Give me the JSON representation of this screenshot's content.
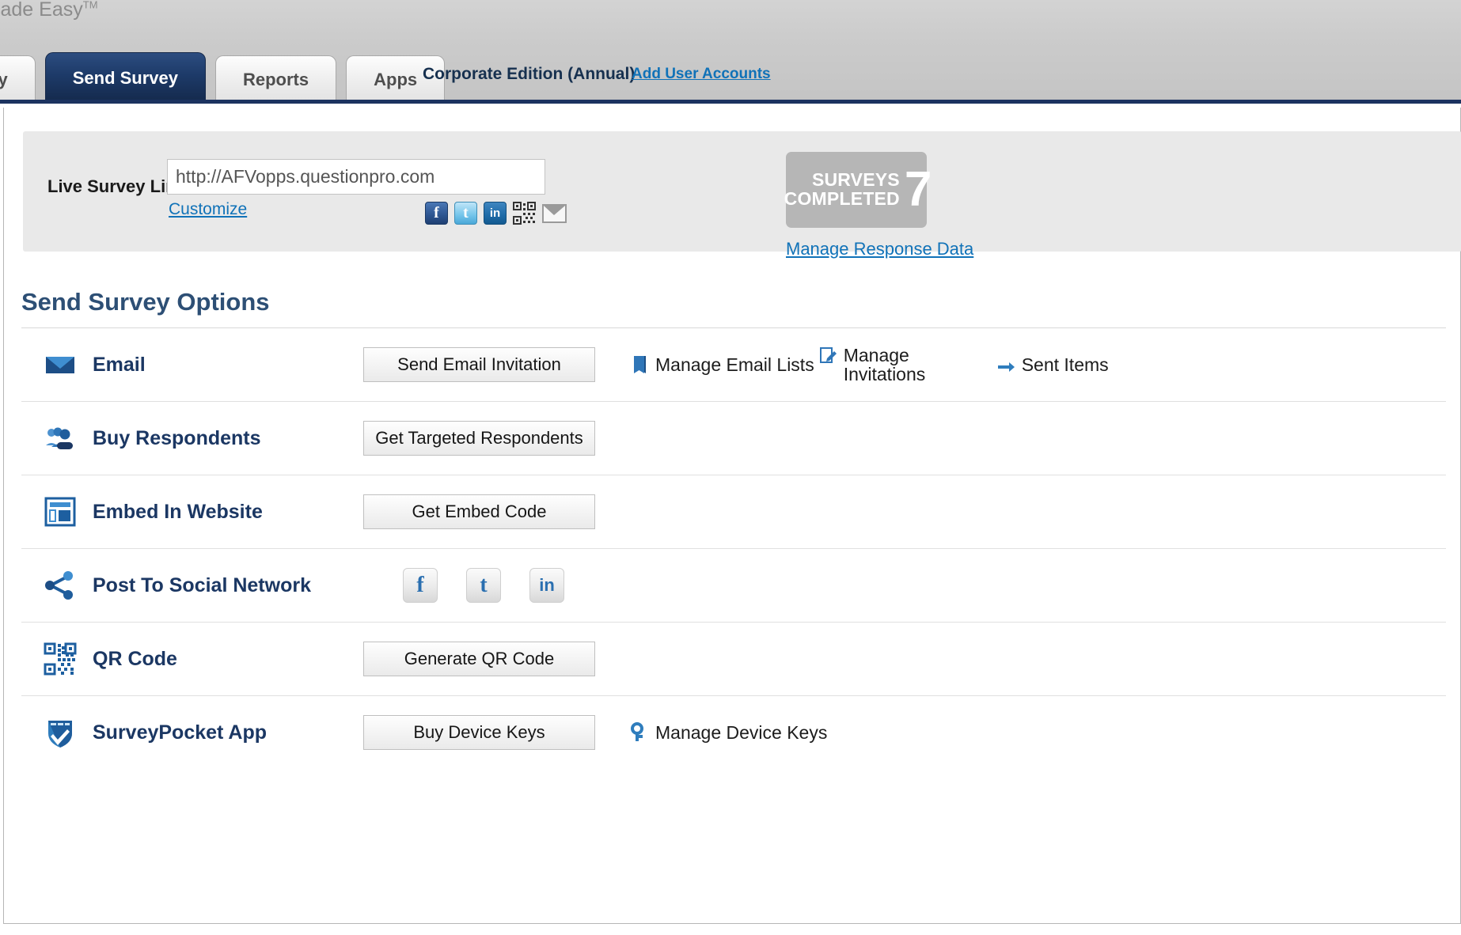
{
  "header": {
    "tagline": "rch Made Easy",
    "tagline_tm": "TM",
    "tabs": [
      {
        "label": "vey",
        "active": false,
        "name": "tab-survey"
      },
      {
        "label": "Send Survey",
        "active": true,
        "name": "tab-send-survey"
      },
      {
        "label": "Reports",
        "active": false,
        "name": "tab-reports"
      },
      {
        "label": "Apps",
        "active": false,
        "name": "tab-apps"
      }
    ],
    "edition": "Corporate Edition (Annual)",
    "add_user_accounts": "Add User Accounts"
  },
  "link_panel": {
    "label": "Live Survey Link",
    "url_value": "http://AFVopps.questionpro.com",
    "url_placeholder": "http://",
    "customize": "Customize",
    "share_icons": [
      {
        "name": "facebook-share-icon",
        "glyph": "f"
      },
      {
        "name": "twitter-share-icon",
        "glyph": "t"
      },
      {
        "name": "linkedin-share-icon",
        "glyph": "in"
      },
      {
        "name": "qr-code-share-icon",
        "glyph": ""
      },
      {
        "name": "email-share-icon",
        "glyph": ""
      }
    ],
    "badge_line1": "SURVEYS",
    "badge_line2": "COMPLETED",
    "badge_count": "7",
    "manage_response_data": "Manage Response Data"
  },
  "options": {
    "title": "Send Survey Options",
    "rows": [
      {
        "name": "email",
        "icon": "envelope-icon",
        "label": "Email",
        "button": "Send Email Invitation",
        "actions": [
          {
            "name": "manage-email-lists",
            "icon": "book-icon",
            "label": "Manage Email Lists",
            "wrap": false
          },
          {
            "name": "manage-invitations",
            "icon": "edit-document-icon",
            "label": "Manage Invitations",
            "wrap": true
          },
          {
            "name": "sent-items",
            "icon": "arrow-right-icon",
            "label": "Sent Items",
            "wrap": false
          }
        ]
      },
      {
        "name": "buy-respondents",
        "icon": "people-group-icon",
        "label": "Buy Respondents",
        "button": "Get Targeted Respondents",
        "actions": []
      },
      {
        "name": "embed-in-website",
        "icon": "website-layout-icon",
        "label": "Embed In Website",
        "button": "Get Embed Code",
        "actions": []
      },
      {
        "name": "post-to-social-network",
        "icon": "share-nodes-icon",
        "label": "Post To Social Network",
        "button": "",
        "social": [
          {
            "name": "facebook-post-button",
            "glyph": "f"
          },
          {
            "name": "twitter-post-button",
            "glyph": "t"
          },
          {
            "name": "linkedin-post-button",
            "glyph": "in"
          }
        ],
        "actions": []
      },
      {
        "name": "qr-code",
        "icon": "qr-code-icon",
        "label": "QR Code",
        "button": "Generate QR Code",
        "actions": []
      },
      {
        "name": "surveypocket-app",
        "icon": "shield-check-icon",
        "label": "SurveyPocket App",
        "button": "Buy Device Keys",
        "actions": [
          {
            "name": "manage-device-keys",
            "icon": "key-icon",
            "label": "Manage Device Keys",
            "wrap": false
          }
        ]
      }
    ]
  },
  "colors": {
    "brand_navy": "#1b3763",
    "link_blue": "#1072b8",
    "active_tab": "#1d3a68",
    "badge_gray": "#b6b6b6"
  }
}
